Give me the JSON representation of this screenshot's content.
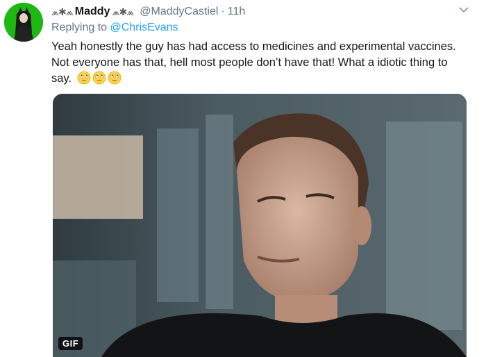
{
  "tweet": {
    "display_name": "Maddy",
    "name_decoration_left": "⩕✱⩕",
    "name_decoration_right": "⩕✱⩕",
    "handle": "@MaddyCastiel",
    "separator": "·",
    "timestamp": "11h",
    "replying_prefix": "Replying to",
    "replying_to": "@ChrisEvans",
    "text": "Yeah honestly the guy has had access to medicines and experimental vaccines. Not everyone has that, hell most people don’t have that! What a idiotic thing to say.",
    "emojis": [
      "face-with-rolling-eyes",
      "face-with-rolling-eyes",
      "face-with-rolling-eyes"
    ],
    "media": {
      "type": "gif",
      "badge": "GIF",
      "description_icon": "video-still"
    },
    "menu_icon": "chevron-down-icon"
  },
  "colors": {
    "link": "#1da1f2",
    "secondary_text": "#657786",
    "avatar_bg": "#1db814"
  }
}
